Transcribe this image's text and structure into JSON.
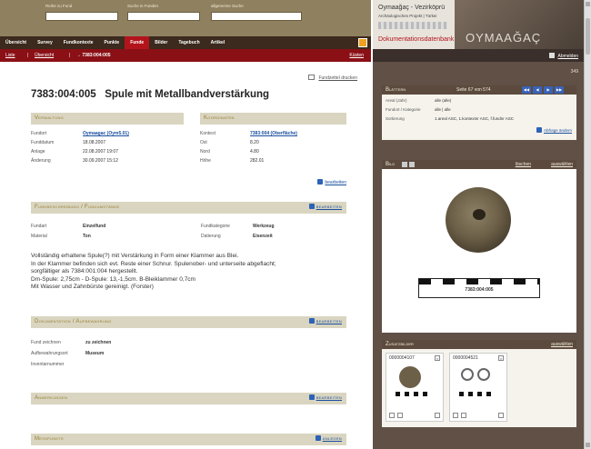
{
  "search": {
    "label1": "Reihe zu Fund",
    "label2": "Suche in Funden",
    "label3": "allgemeine Suche"
  },
  "nav": {
    "items": [
      "Übersicht",
      "Survey",
      "Fundkontexte",
      "Punkte",
      "Funde",
      "Bilder",
      "Tagebuch",
      "Artikel"
    ],
    "active": "Funde"
  },
  "subnav": {
    "liste": "Liste",
    "uebersicht": "Übersicht",
    "current": "→ 7383:004:005",
    "right": "Küsten"
  },
  "main": {
    "print_link": "Fundzettel drucken",
    "title_id": "7383:004:005",
    "title_desc": "Spule mit Metallbandverstärkung",
    "verwaltung": {
      "head": "Verwaltung",
      "fundort_k": "Fundort",
      "fundort_v": "Oymaagac (Oym5.01)",
      "funddatum_k": "Funddatum",
      "funddatum_v": "18.08.2007",
      "anlage_k": "Anlage",
      "anlage_v": "22.08.2007 19:07",
      "aenderung_k": "Änderung",
      "aenderung_v": "30.09.2007 15:12"
    },
    "koordinaten": {
      "head": "Koordinaten",
      "kontext_k": "Kontext",
      "kontext_v": "7383:004 (Oberfläche)",
      "ost_k": "Ost",
      "ost_v": "8.20",
      "nord_k": "Nord",
      "nord_v": "4.80",
      "hoehe_k": "Höhe",
      "hoehe_v": "282.01"
    },
    "edit": "bearbeiten",
    "fundbeschreibung": {
      "head": "Fundbeschreibung / Fundumstände",
      "fundart_k": "Fundart",
      "fundart_v": "Einzelfund",
      "material_k": "Material",
      "material_v": "Ton",
      "kat_k": "Fundkategorie",
      "kat_v": "Werkzeug",
      "dat_k": "Datierung",
      "dat_v": "Eisenzeit",
      "text1": "Vollständig erhaltene Spule(?) mit Verstärkung in Form einer Klammer aus Blei.",
      "text2": "In der Klammer befinden sich evt. Reste einer Schnur. Spulenober- und unterseite abgeflacht;",
      "text3": "sorgfältiger als 7384:001:004 hergestellt.",
      "text4": "Dm-Spule: 2,75cm - D-Spule: 13,-1,5cm. B-Bleiklammer 0,7cm",
      "text5": "Mit Wasser und Zahnbürste gereinigt. (Forster)"
    },
    "dokumentation": {
      "head": "Dokumentation / Aufbewahrung",
      "zeichnen_k": "Fund zeichnen",
      "zeichnen_v": "zu zeichnen",
      "aufbew_k": "Aufbewahrungsort",
      "aufbew_v": "Museum",
      "inv_k": "Inventarnummer"
    },
    "anmerkungen": {
      "head": "Anmerkungen"
    },
    "messpunkte": {
      "head": "Messpunkte",
      "link": "anlegen"
    }
  },
  "right": {
    "header_title": "Oymaağaç - Vezirköprü",
    "header_sub": "Archäologisches Projekt | Türkei",
    "header_doc": "Dokumentationsdatenbank",
    "header_logo": "OYMAAĞAÇ",
    "abmelden": "Abmelden",
    "count": "349",
    "blaettern": {
      "head": "Blättern",
      "page": "Seite 67 von 574",
      "areal_k": "Areal (Jahr)",
      "areal_v": "alle (alle)",
      "kat_k": "Fundort / Kategorie",
      "kat_v": "alle | alle",
      "sort_k": "Sortierung",
      "sort_v": "1.areal ASC, 1.kontextnr ASC, f.fundnr ASC",
      "change": "Abfrage ändern"
    },
    "bild": {
      "head": "Bild",
      "loeschen": "löschen",
      "auswaehlen": "auswählen",
      "scale_label": "7383:004:005"
    },
    "zusatz": {
      "head": "Zusatzbilder",
      "auswaehlen": "auswählen",
      "thumb1": "0000004107",
      "thumb2": "0000004521"
    }
  },
  "colors": {
    "nav_bg": "#3b2a1d",
    "active": "#b3141c",
    "accent": "#9a7d30",
    "link": "#1a4fa0"
  }
}
